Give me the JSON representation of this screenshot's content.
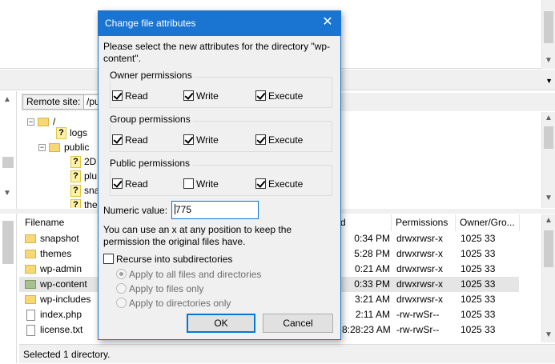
{
  "remote_site": {
    "label": "Remote site:",
    "path": "/pu"
  },
  "tree": {
    "root": "/",
    "items": [
      "logs",
      "public",
      "2D",
      "plu",
      "sna",
      "the"
    ]
  },
  "file_list": {
    "columns": {
      "filename": "Filename",
      "modified": "d",
      "permissions": "Permissions",
      "owner": "Owner/Gro..."
    },
    "rows": [
      {
        "name": "snapshot",
        "modified": "0:34 PM",
        "permissions": "drwxrwsr-x",
        "owner": "1025 33"
      },
      {
        "name": "themes",
        "modified": "5:28 PM",
        "permissions": "drwxrwsr-x",
        "owner": "1025 33"
      },
      {
        "name": "wp-admin",
        "modified": "0:21 AM",
        "permissions": "drwxrwsr-x",
        "owner": "1025 33"
      },
      {
        "name": "wp-content",
        "modified": "0:33 PM",
        "permissions": "drwxrwsr-x",
        "owner": "1025 33"
      },
      {
        "name": "wp-includes",
        "modified": "3:21 AM",
        "permissions": "drwxrwsr-x",
        "owner": "1025 33"
      },
      {
        "name": "index.php",
        "modified": "2:11 AM",
        "permissions": "-rw-rwSr--",
        "owner": "1025 33"
      },
      {
        "name": "license.txt",
        "modified": "8:28:23 AM",
        "permissions": "-rw-rwSr--",
        "owner": "1025 33"
      }
    ]
  },
  "status_bar": "Selected 1 directory.",
  "dialog": {
    "title": "Change file attributes",
    "description": "Please select the new attributes for the directory \"wp-content\".",
    "groups": [
      {
        "label": "Owner permissions",
        "read": "Read",
        "write": "Write",
        "execute": "Execute"
      },
      {
        "label": "Group permissions",
        "read": "Read",
        "write": "Write",
        "execute": "Execute"
      },
      {
        "label": "Public permissions",
        "read": "Read",
        "write": "Write",
        "execute": "Execute"
      }
    ],
    "numeric_label": "Numeric value:",
    "numeric_value": "775",
    "hint": "You can use an x at any position to keep the permission the original files have.",
    "recurse_label": "Recurse into subdirectories",
    "apply_options": [
      "Apply to all files and directories",
      "Apply to files only",
      "Apply to directories only"
    ],
    "ok_label": "OK",
    "cancel_label": "Cancel"
  }
}
